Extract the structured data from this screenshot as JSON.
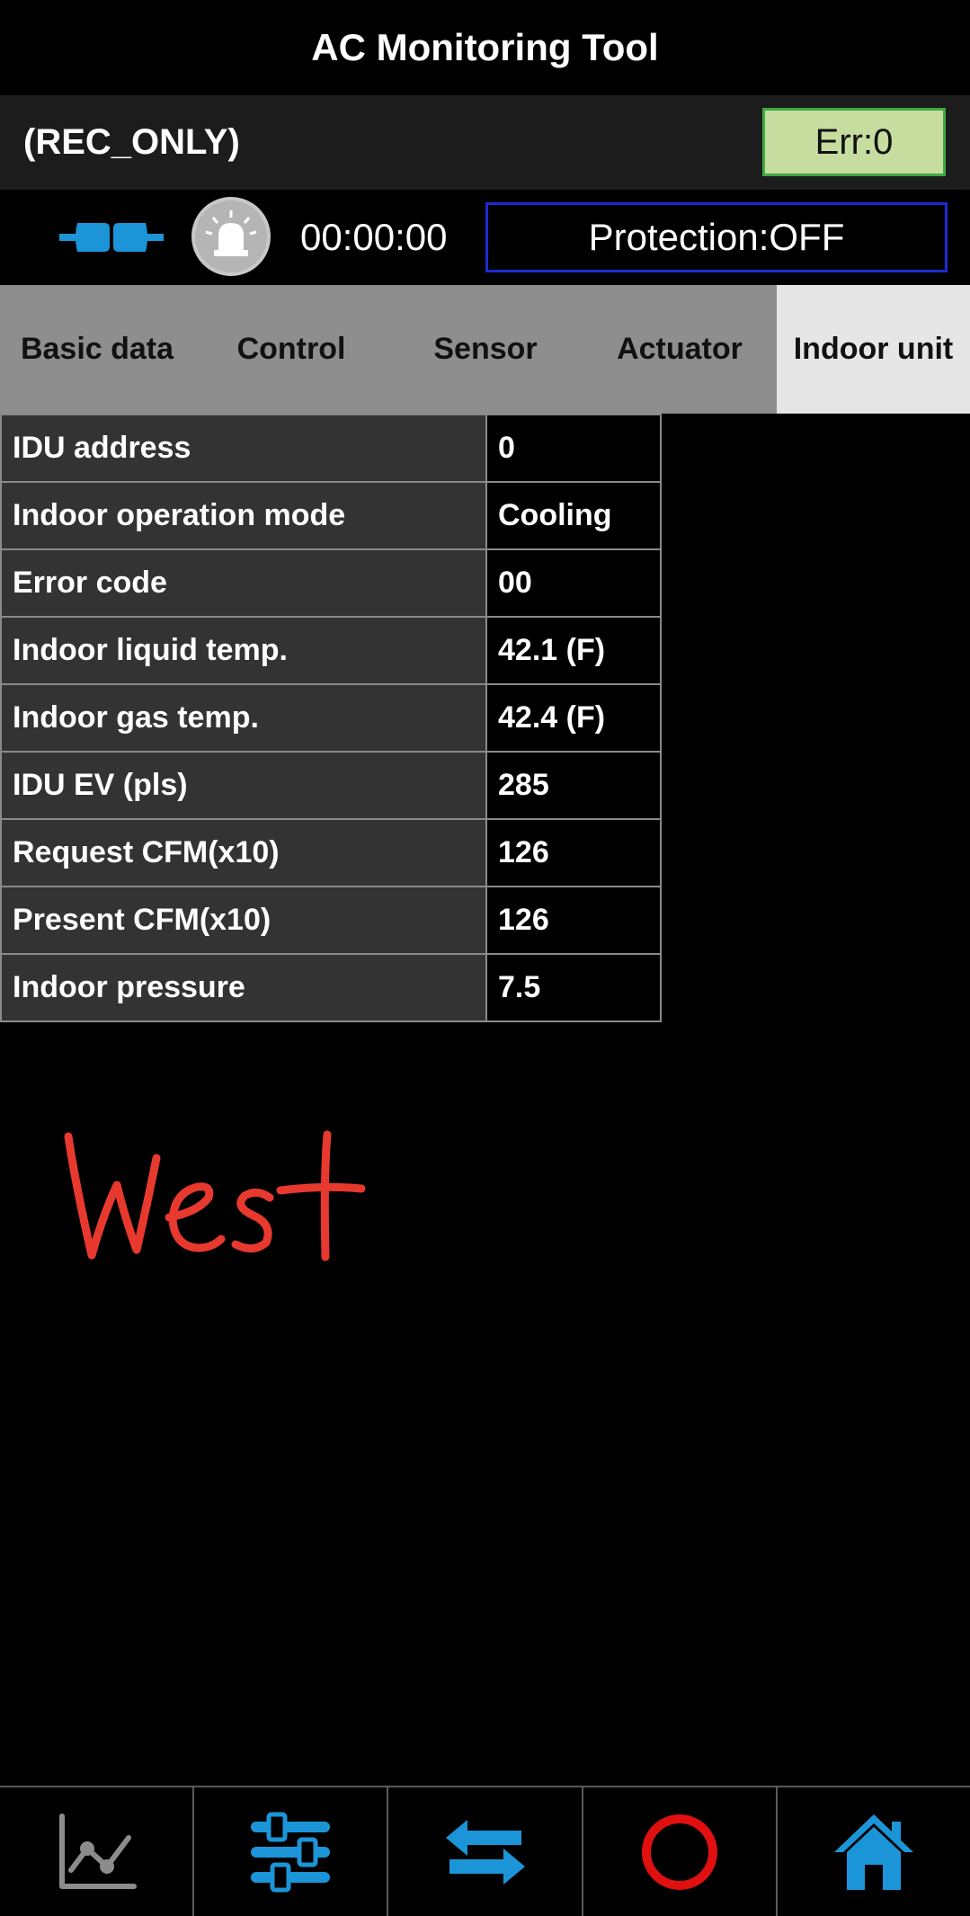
{
  "app": {
    "title": "AC Monitoring Tool"
  },
  "mode": {
    "label": "(REC_ONLY)",
    "error_badge": "Err:0"
  },
  "status": {
    "connection_icon": "plug-connected-icon",
    "alarm_icon": "alarm-siren-icon",
    "timer": "00:00:00",
    "protection": "Protection:OFF"
  },
  "tabs": [
    {
      "label": "Basic data",
      "active": false
    },
    {
      "label": "Control",
      "active": false
    },
    {
      "label": "Sensor",
      "active": false
    },
    {
      "label": "Actuator",
      "active": false
    },
    {
      "label": "Indoor unit",
      "active": true
    }
  ],
  "table": {
    "rows": [
      {
        "label": "IDU address",
        "value": "0"
      },
      {
        "label": "Indoor operation mode",
        "value": "Cooling"
      },
      {
        "label": "Error code",
        "value": "00"
      },
      {
        "label": "Indoor liquid temp.",
        "value": "42.1 (F)"
      },
      {
        "label": "Indoor gas temp.",
        "value": "42.4 (F)"
      },
      {
        "label": "IDU EV (pls)",
        "value": "285"
      },
      {
        "label": "Request CFM(x10)",
        "value": "126"
      },
      {
        "label": "Present CFM(x10)",
        "value": "126"
      },
      {
        "label": "Indoor pressure",
        "value": "7.5"
      }
    ]
  },
  "annotation": {
    "handwritten_text": "West",
    "color": "#e8392e"
  },
  "bottom_nav": {
    "icons": [
      "graph-icon",
      "sliders-icon",
      "swap-arrows-icon",
      "record-icon",
      "home-icon"
    ]
  },
  "colors": {
    "accent_blue": "#1b95d8",
    "record_red": "#e01010",
    "err_green": "#c6dd9f",
    "protection_border": "#1a2bd0"
  }
}
